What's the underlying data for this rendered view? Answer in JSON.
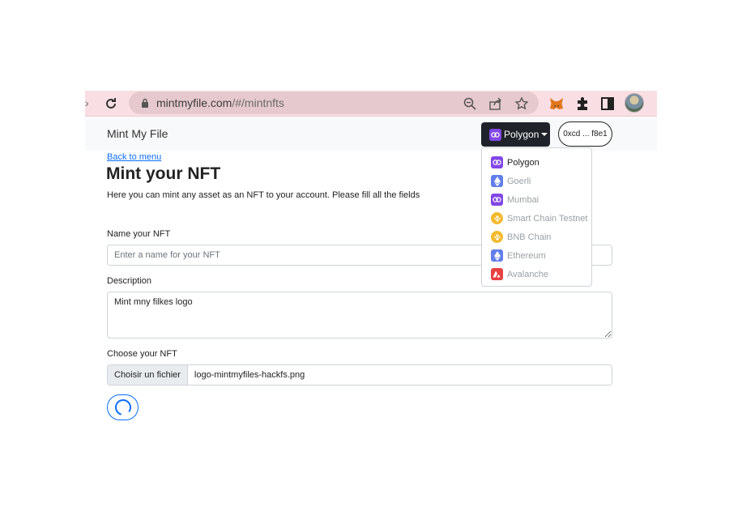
{
  "browser": {
    "url_domain": "mintmyfile.com",
    "url_path": "/#/mintnfts"
  },
  "navbar": {
    "brand": "Mint My File",
    "network_button": "Polygon",
    "account_button": "0xcd ... f8e1"
  },
  "networks": [
    {
      "name": "Polygon",
      "icon": "polygon-icon",
      "color": "#8247e5"
    },
    {
      "name": "Goerli",
      "icon": "ethereum-icon",
      "color": "#627eea"
    },
    {
      "name": "Mumbai",
      "icon": "polygon-icon",
      "color": "#8247e5"
    },
    {
      "name": "Smart Chain Testnet",
      "icon": "bnb-icon",
      "color": "#f3ba2f"
    },
    {
      "name": "BNB Chain",
      "icon": "bnb-icon",
      "color": "#f3ba2f"
    },
    {
      "name": "Ethereum",
      "icon": "ethereum-icon",
      "color": "#627eea"
    },
    {
      "name": "Avalanche",
      "icon": "avalanche-icon",
      "color": "#e84142"
    }
  ],
  "page": {
    "back_link": "Back to menu",
    "title": "Mint your NFT",
    "subtitle": "Here you can mint any asset as an NFT to your account. Please fill all the fields"
  },
  "form": {
    "name_label": "Name your NFT",
    "name_placeholder": "Enter a name for your NFT",
    "name_value": "",
    "description_label": "Description",
    "description_value": "Mint mny filkes logo",
    "file_label": "Choose your NFT",
    "file_button": "Choisir un fichier",
    "file_name": "logo-mintmyfiles-hackfs.png"
  },
  "colors": {
    "accent": "#0d6efd",
    "chrome_bg": "#f9dfe3",
    "navbar_bg": "#f8f9fa",
    "network_button_bg": "#1f2329"
  }
}
